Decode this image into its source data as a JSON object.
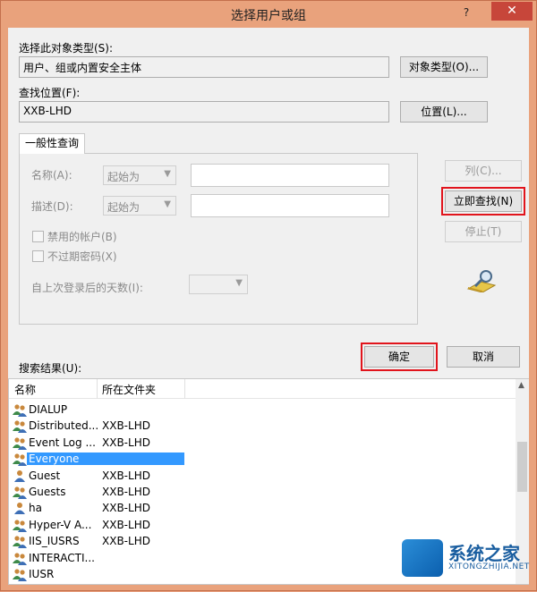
{
  "window": {
    "title": "选择用户或组",
    "help": "?",
    "close": "✕"
  },
  "object_type": {
    "label": "选择此对象类型(S):",
    "value": "用户、组或内置安全主体",
    "button": "对象类型(O)..."
  },
  "location": {
    "label": "查找位置(F):",
    "value": "XXB-LHD",
    "button": "位置(L)..."
  },
  "general_query": {
    "tab": "一般性查询",
    "name_label": "名称(A):",
    "name_mode": "起始为",
    "desc_label": "描述(D):",
    "desc_mode": "起始为",
    "disabled_accounts": "禁用的帐户(B)",
    "non_expiring_pwd": "不过期密码(X)",
    "days_since_login": "自上次登录后的天数(I):"
  },
  "side_buttons": {
    "columns": "列(C)...",
    "find_now": "立即查找(N)",
    "stop": "停止(T)"
  },
  "dialog_buttons": {
    "ok": "确定",
    "cancel": "取消"
  },
  "results": {
    "label": "搜索结果(U):",
    "columns": [
      "名称",
      "所在文件夹"
    ],
    "rows": [
      {
        "name": "DIALUP",
        "folder": "",
        "type": "group"
      },
      {
        "name": "Distributed...",
        "folder": "XXB-LHD",
        "type": "group"
      },
      {
        "name": "Event Log ...",
        "folder": "XXB-LHD",
        "type": "group"
      },
      {
        "name": "Everyone",
        "folder": "",
        "type": "group",
        "selected": true
      },
      {
        "name": "Guest",
        "folder": "XXB-LHD",
        "type": "user"
      },
      {
        "name": "Guests",
        "folder": "XXB-LHD",
        "type": "group"
      },
      {
        "name": "ha",
        "folder": "XXB-LHD",
        "type": "user"
      },
      {
        "name": "Hyper-V A...",
        "folder": "XXB-LHD",
        "type": "group"
      },
      {
        "name": "IIS_IUSRS",
        "folder": "XXB-LHD",
        "type": "group"
      },
      {
        "name": "INTERACTI...",
        "folder": "",
        "type": "group"
      },
      {
        "name": "IUSR",
        "folder": "",
        "type": "group"
      }
    ]
  },
  "watermark": {
    "name": "系统之家",
    "url": "XITONGZHIJIA.NET"
  },
  "colors": {
    "titlebar": "#e9a27c",
    "close": "#c7463a",
    "selection": "#3399ff",
    "highlight": "#e1141c"
  }
}
